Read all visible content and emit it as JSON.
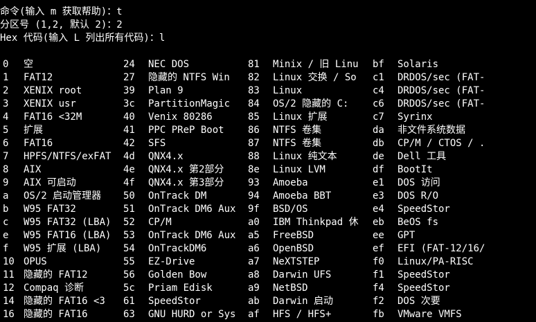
{
  "colors": {
    "background": "#000000",
    "text": "#ffffff"
  },
  "prompts": [
    "命令(输入 m 获取帮助)：t",
    "分区号 (1,2, 默认 2)：2",
    "Hex 代码(输入 L 列出所有代码)：l"
  ],
  "partition_types": [
    [
      [
        "0",
        "空"
      ],
      [
        "24",
        "NEC DOS"
      ],
      [
        "81",
        "Minix / 旧 Linu"
      ],
      [
        "bf",
        "Solaris"
      ]
    ],
    [
      [
        "1",
        "FAT12"
      ],
      [
        "27",
        "隐藏的 NTFS Win"
      ],
      [
        "82",
        "Linux 交换 / So"
      ],
      [
        "c1",
        "DRDOS/sec (FAT-"
      ]
    ],
    [
      [
        "2",
        "XENIX root"
      ],
      [
        "39",
        "Plan 9"
      ],
      [
        "83",
        "Linux"
      ],
      [
        "c4",
        "DRDOS/sec (FAT-"
      ]
    ],
    [
      [
        "3",
        "XENIX usr"
      ],
      [
        "3c",
        "PartitionMagic"
      ],
      [
        "84",
        "OS/2 隐藏的 C:"
      ],
      [
        "c6",
        "DRDOS/sec (FAT-"
      ]
    ],
    [
      [
        "4",
        "FAT16 <32M"
      ],
      [
        "40",
        "Venix 80286"
      ],
      [
        "85",
        "Linux 扩展"
      ],
      [
        "c7",
        "Syrinx"
      ]
    ],
    [
      [
        "5",
        "扩展"
      ],
      [
        "41",
        "PPC PReP Boot"
      ],
      [
        "86",
        "NTFS 卷集"
      ],
      [
        "da",
        "非文件系统数据"
      ]
    ],
    [
      [
        "6",
        "FAT16"
      ],
      [
        "42",
        "SFS"
      ],
      [
        "87",
        "NTFS 卷集"
      ],
      [
        "db",
        "CP/M / CTOS / ."
      ]
    ],
    [
      [
        "7",
        "HPFS/NTFS/exFAT"
      ],
      [
        "4d",
        "QNX4.x"
      ],
      [
        "88",
        "Linux 纯文本"
      ],
      [
        "de",
        "Dell 工具"
      ]
    ],
    [
      [
        "8",
        "AIX"
      ],
      [
        "4e",
        "QNX4.x 第2部分"
      ],
      [
        "8e",
        "Linux LVM"
      ],
      [
        "df",
        "BootIt"
      ]
    ],
    [
      [
        "9",
        "AIX 可启动"
      ],
      [
        "4f",
        "QNX4.x 第3部分"
      ],
      [
        "93",
        "Amoeba"
      ],
      [
        "e1",
        "DOS 访问"
      ]
    ],
    [
      [
        "a",
        "OS/2 启动管理器"
      ],
      [
        "50",
        "OnTrack DM"
      ],
      [
        "94",
        "Amoeba BBT"
      ],
      [
        "e3",
        "DOS R/O"
      ]
    ],
    [
      [
        "b",
        "W95 FAT32"
      ],
      [
        "51",
        "OnTrack DM6 Aux"
      ],
      [
        "9f",
        "BSD/OS"
      ],
      [
        "e4",
        "SpeedStor"
      ]
    ],
    [
      [
        "c",
        "W95 FAT32 (LBA)"
      ],
      [
        "52",
        "CP/M"
      ],
      [
        "a0",
        "IBM Thinkpad 休"
      ],
      [
        "eb",
        "BeOS fs"
      ]
    ],
    [
      [
        "e",
        "W95 FAT16 (LBA)"
      ],
      [
        "53",
        "OnTrack DM6 Aux"
      ],
      [
        "a5",
        "FreeBSD"
      ],
      [
        "ee",
        "GPT"
      ]
    ],
    [
      [
        "f",
        "W95 扩展 (LBA)"
      ],
      [
        "54",
        "OnTrackDM6"
      ],
      [
        "a6",
        "OpenBSD"
      ],
      [
        "ef",
        "EFI (FAT-12/16/"
      ]
    ],
    [
      [
        "10",
        "OPUS"
      ],
      [
        "55",
        "EZ-Drive"
      ],
      [
        "a7",
        "NeXTSTEP"
      ],
      [
        "f0",
        "Linux/PA-RISC"
      ]
    ],
    [
      [
        "11",
        "隐藏的 FAT12"
      ],
      [
        "56",
        "Golden Bow"
      ],
      [
        "a8",
        "Darwin UFS"
      ],
      [
        "f1",
        "SpeedStor"
      ]
    ],
    [
      [
        "12",
        "Compaq 诊断"
      ],
      [
        "5c",
        "Priam Edisk"
      ],
      [
        "a9",
        "NetBSD"
      ],
      [
        "f4",
        "SpeedStor"
      ]
    ],
    [
      [
        "14",
        "隐藏的 FAT16 <3"
      ],
      [
        "61",
        "SpeedStor"
      ],
      [
        "ab",
        "Darwin 启动"
      ],
      [
        "f2",
        "DOS 次要"
      ]
    ],
    [
      [
        "16",
        "隐藏的 FAT16"
      ],
      [
        "63",
        "GNU HURD or Sys"
      ],
      [
        "af",
        "HFS / HFS+"
      ],
      [
        "fb",
        "VMware VMFS"
      ]
    ]
  ]
}
